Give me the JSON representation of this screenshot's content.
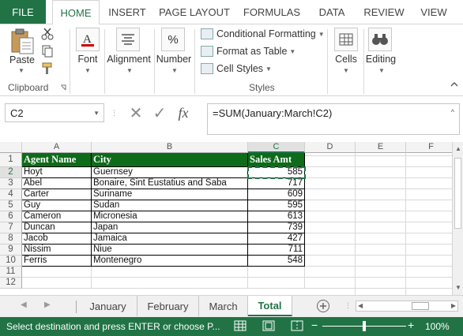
{
  "ribbon_tabs": [
    {
      "label": "FILE"
    },
    {
      "label": "HOME"
    },
    {
      "label": "INSERT"
    },
    {
      "label": "PAGE LAYOUT"
    },
    {
      "label": "FORMULAS"
    },
    {
      "label": "DATA"
    },
    {
      "label": "REVIEW"
    },
    {
      "label": "VIEW"
    }
  ],
  "clipboard": {
    "paste_label": "Paste",
    "group_label": "Clipboard"
  },
  "font": {
    "label": "Font"
  },
  "alignment": {
    "label": "Alignment"
  },
  "number": {
    "label": "Number",
    "icon_glyph": "%"
  },
  "styles": {
    "conditional_formatting": "Conditional Formatting",
    "format_as_table": "Format as Table",
    "cell_styles": "Cell Styles",
    "group_label": "Styles"
  },
  "cells": {
    "label": "Cells"
  },
  "editing": {
    "label": "Editing"
  },
  "formula_bar": {
    "name_box": "C2",
    "fx_glyph": "fx",
    "formula": "=SUM(January:March!C2)"
  },
  "columns": [
    "A",
    "B",
    "C",
    "D",
    "E",
    "F"
  ],
  "rows": [
    "1",
    "2",
    "3",
    "4",
    "5",
    "6",
    "7",
    "8",
    "9",
    "10",
    "11",
    "12"
  ],
  "table": {
    "headers": [
      "Agent Name",
      "City",
      "Sales Amt"
    ],
    "rows": [
      [
        "Hoyt",
        "Guernsey",
        "585"
      ],
      [
        "Abel",
        "Bonaire, Sint Eustatius and Saba",
        "717"
      ],
      [
        "Carter",
        "Suriname",
        "609"
      ],
      [
        "Guy",
        "Sudan",
        "595"
      ],
      [
        "Cameron",
        "Micronesia",
        "613"
      ],
      [
        "Duncan",
        "Japan",
        "739"
      ],
      [
        "Jacob",
        "Jamaica",
        "427"
      ],
      [
        "Nissim",
        "Niue",
        "711"
      ],
      [
        "Ferris",
        "Montenegro",
        "548"
      ]
    ]
  },
  "sheet_tabs": [
    {
      "label": "January"
    },
    {
      "label": "February"
    },
    {
      "label": "March"
    },
    {
      "label": "Total"
    }
  ],
  "status": {
    "message": "Select destination and press ENTER or choose P...",
    "zoom": "100%"
  },
  "colors": {
    "accent": "#217346",
    "header_fill": "#0d6b1a"
  }
}
